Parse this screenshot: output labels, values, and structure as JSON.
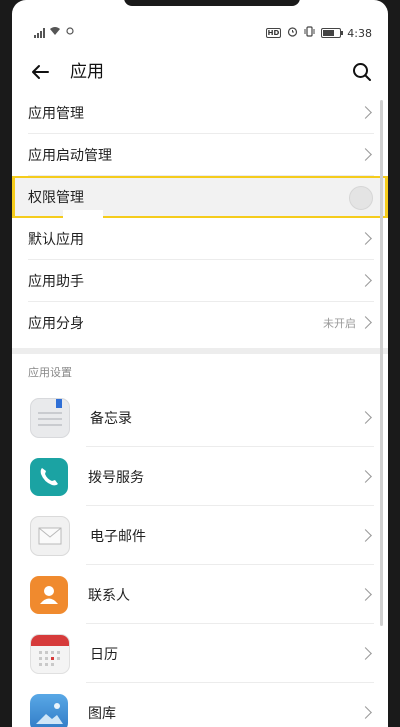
{
  "status_bar": {
    "time": "4:38",
    "hd_label": "HD"
  },
  "header": {
    "title": "应用",
    "back_icon": "back-arrow-icon",
    "search_icon": "search-icon"
  },
  "settings_rows": [
    {
      "label": "应用管理"
    },
    {
      "label": "应用启动管理"
    },
    {
      "label": "权限管理"
    },
    {
      "label": "默认应用"
    },
    {
      "label": "应用助手"
    },
    {
      "label": "应用分身",
      "value": "未开启"
    }
  ],
  "app_settings": {
    "section_label": "应用设置",
    "apps": [
      {
        "label": "备忘录",
        "icon": "notepad-icon"
      },
      {
        "label": "拨号服务",
        "icon": "phone-icon"
      },
      {
        "label": "电子邮件",
        "icon": "envelope-icon"
      },
      {
        "label": "联系人",
        "icon": "contact-person-icon"
      },
      {
        "label": "日历",
        "icon": "calendar-icon"
      },
      {
        "label": "图库",
        "icon": "gallery-icon"
      }
    ]
  },
  "colors": {
    "highlight_border": "#f5cc1c",
    "dialer": "#1ba3a3",
    "contacts": "#f08a2e",
    "calendar_red": "#d63b3b"
  }
}
